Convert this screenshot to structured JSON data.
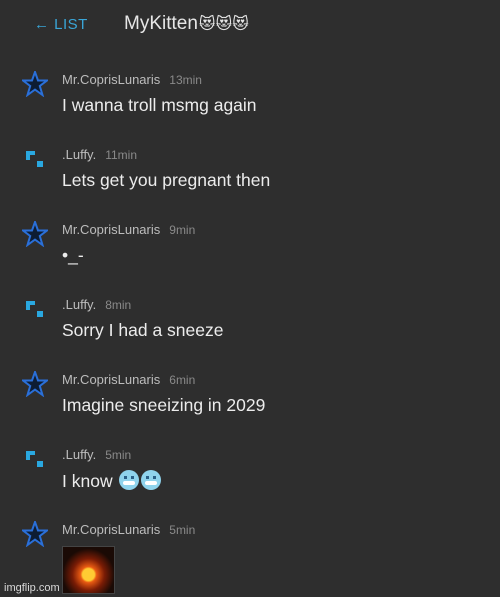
{
  "header": {
    "back_label": "← LIST",
    "title": "MyKitten",
    "title_emoji": "😻😻😻"
  },
  "messages": [
    {
      "avatar": "star-icon",
      "user": "Mr.CoprisLunaris",
      "time": "13min",
      "text": "I wanna troll msmg again"
    },
    {
      "avatar": "pixel-icon",
      "user": ".Luffy.",
      "time": "11min",
      "text": "Lets get you pregnant then"
    },
    {
      "avatar": "star-icon",
      "user": "Mr.CoprisLunaris",
      "time": "9min",
      "text": "•_-"
    },
    {
      "avatar": "pixel-icon",
      "user": ".Luffy.",
      "time": "8min",
      "text": "Sorry I had a sneeze"
    },
    {
      "avatar": "star-icon",
      "user": "Mr.CoprisLunaris",
      "time": "6min",
      "text": "Imagine sneeizing in 2029"
    },
    {
      "avatar": "pixel-icon",
      "user": ".Luffy.",
      "time": "5min",
      "text": "I know",
      "emoji_icons": [
        "cold-face-icon",
        "cold-face-icon"
      ]
    },
    {
      "avatar": "star-icon",
      "user": "Mr.CoprisLunaris",
      "time": "5min",
      "image": "explosion-image"
    }
  ],
  "watermark": "imgflip.com",
  "colors": {
    "background": "#2e2e2e",
    "accent": "#3aa6d8",
    "star": "#2a6fd8"
  }
}
